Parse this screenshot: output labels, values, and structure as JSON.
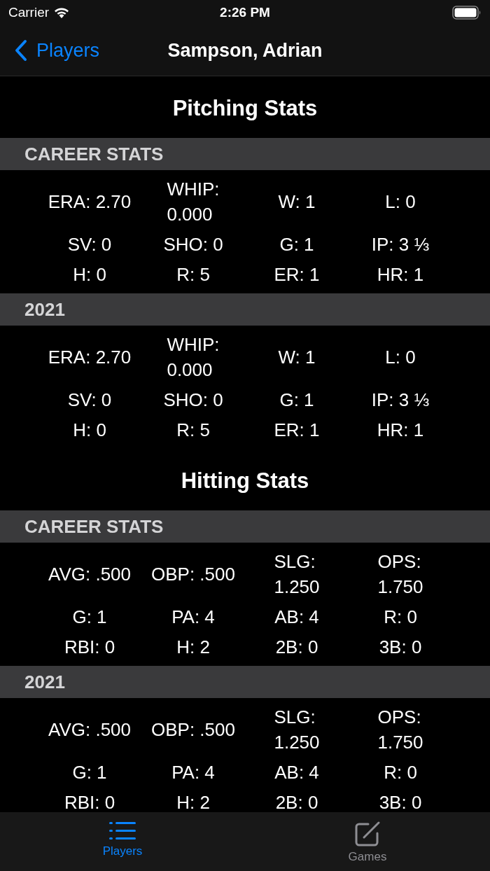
{
  "status_bar": {
    "carrier": "Carrier",
    "time": "2:26 PM"
  },
  "nav": {
    "back": "Players",
    "title": "Sampson, Adrian"
  },
  "groups": [
    {
      "title": "Pitching Stats",
      "sections": [
        {
          "header": "CAREER STATS",
          "stats": [
            "ERA: 2.70",
            "WHIP: 0.000",
            "W: 1",
            "L: 0",
            "SV: 0",
            "SHO: 0",
            "G: 1",
            "IP: 3 ⅓",
            "H: 0",
            "R: 5",
            "ER: 1",
            "HR: 1"
          ]
        },
        {
          "header": "2021",
          "stats": [
            "ERA: 2.70",
            "WHIP: 0.000",
            "W: 1",
            "L: 0",
            "SV: 0",
            "SHO: 0",
            "G: 1",
            "IP: 3 ⅓",
            "H: 0",
            "R: 5",
            "ER: 1",
            "HR: 1"
          ]
        }
      ]
    },
    {
      "title": "Hitting Stats",
      "sections": [
        {
          "header": "CAREER STATS",
          "stats": [
            "AVG: .500",
            "OBP: .500",
            "SLG: 1.250",
            "OPS: 1.750",
            "G: 1",
            "PA: 4",
            "AB: 4",
            "R: 0",
            "RBI: 0",
            "H: 2",
            "2B: 0",
            "3B: 0"
          ]
        },
        {
          "header": "2021",
          "stats": [
            "AVG: .500",
            "OBP: .500",
            "SLG: 1.250",
            "OPS: 1.750",
            "G: 1",
            "PA: 4",
            "AB: 4",
            "R: 0",
            "RBI: 0",
            "H: 2",
            "2B: 0",
            "3B: 0"
          ]
        }
      ]
    }
  ],
  "tabs": [
    {
      "label": "Players",
      "kind": "list",
      "selected": true
    },
    {
      "label": "Games",
      "kind": "compose",
      "selected": false
    }
  ]
}
